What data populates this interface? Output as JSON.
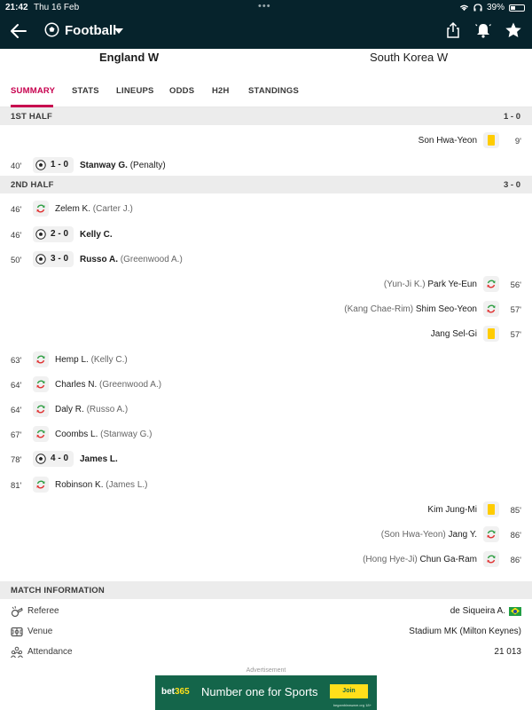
{
  "status_bar": {
    "time": "21:42",
    "date": "Thu 16 Feb",
    "battery": "39%",
    "battery_level": 0.39
  },
  "nav": {
    "sport": "Football"
  },
  "teams": {
    "home": "England W",
    "away": "South Korea W"
  },
  "tabs": [
    "SUMMARY",
    "STATS",
    "LINEUPS",
    "ODDS",
    "H2H",
    "STANDINGS"
  ],
  "first_half": {
    "title": "1ST HALF",
    "score": "1 - 0",
    "events": [
      {
        "minute": "9'",
        "side": "away",
        "type": "yellow-card",
        "player": "Son Hwa-Yeon"
      },
      {
        "minute": "40'",
        "side": "home",
        "type": "goal",
        "score": "1 - 0",
        "player": "Stanway G.",
        "detail": "(Penalty)"
      }
    ]
  },
  "second_half": {
    "title": "2ND HALF",
    "score": "3 - 0",
    "events": [
      {
        "minute": "46'",
        "side": "home",
        "type": "substitution",
        "player": "Zelem K.",
        "detail": "(Carter J.)"
      },
      {
        "minute": "46'",
        "side": "home",
        "type": "goal",
        "score": "2 - 0",
        "player": "Kelly C."
      },
      {
        "minute": "50'",
        "side": "home",
        "type": "goal",
        "score": "3 - 0",
        "player": "Russo A.",
        "detail": "(Greenwood A.)"
      },
      {
        "minute": "56'",
        "side": "away",
        "type": "substitution",
        "player": "Park Ye-Eun",
        "detail": "(Yun-Ji K.)"
      },
      {
        "minute": "57'",
        "side": "away",
        "type": "substitution",
        "player": "Shim Seo-Yeon",
        "detail": "(Kang Chae-Rim)"
      },
      {
        "minute": "57'",
        "side": "away",
        "type": "yellow-card",
        "player": "Jang Sel-Gi"
      },
      {
        "minute": "63'",
        "side": "home",
        "type": "substitution",
        "player": "Hemp L.",
        "detail": "(Kelly C.)"
      },
      {
        "minute": "64'",
        "side": "home",
        "type": "substitution",
        "player": "Charles N.",
        "detail": "(Greenwood A.)"
      },
      {
        "minute": "64'",
        "side": "home",
        "type": "substitution",
        "player": "Daly R.",
        "detail": "(Russo A.)"
      },
      {
        "minute": "67'",
        "side": "home",
        "type": "substitution",
        "player": "Coombs L.",
        "detail": "(Stanway G.)"
      },
      {
        "minute": "78'",
        "side": "home",
        "type": "goal",
        "score": "4 - 0",
        "player": "James L."
      },
      {
        "minute": "81'",
        "side": "home",
        "type": "substitution",
        "player": "Robinson K.",
        "detail": "(James L.)"
      },
      {
        "minute": "85'",
        "side": "away",
        "type": "yellow-card",
        "player": "Kim Jung-Mi"
      },
      {
        "minute": "86'",
        "side": "away",
        "type": "substitution",
        "player": "Jang Y.",
        "detail": "(Son Hwa-Yeon)"
      },
      {
        "minute": "86'",
        "side": "away",
        "type": "substitution",
        "player": "Chun Ga-Ram",
        "detail": "(Hong Hye-Ji)"
      }
    ]
  },
  "match_info": {
    "title": "MATCH INFORMATION",
    "rows": [
      {
        "icon": "whistle-icon",
        "label": "Referee",
        "value": "de Siqueira A.",
        "flag": "brazil-flag-icon"
      },
      {
        "icon": "stadium-icon",
        "label": "Venue",
        "value": "Stadium MK (Milton Keynes)"
      },
      {
        "icon": "people-icon",
        "label": "Attendance",
        "value": "21 013"
      }
    ]
  },
  "ad": {
    "label": "Advertisement",
    "brand_main": "bet",
    "brand_accent": "365",
    "slogan": "Number one for Sports",
    "cta": "Join",
    "fine_print": "begambleaware.org 18+"
  },
  "colors": {
    "header_bg": "#06232c",
    "accent": "#c7004e",
    "section_bg": "#ececec",
    "yellow_card": "#ffcc00",
    "sub_in": "#2f9e44",
    "sub_out": "#e03131",
    "ad_bg": "#14654a"
  }
}
